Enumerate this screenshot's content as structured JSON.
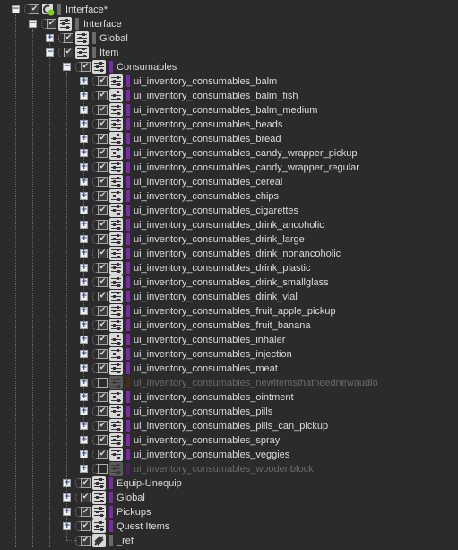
{
  "colors": {
    "background": "#2b2b2b",
    "text": "#dcdcdc",
    "text_disabled": "#6a6a6a",
    "bar_purple": "#7a2aa8",
    "bar_purple_disabled": "#4a1f5c",
    "bar_brown_disabled": "#4a2a14",
    "bar_gray": "#6b6b6b",
    "active_dot": "#7ed321"
  },
  "tree": {
    "root": {
      "label": "Interface*",
      "checked": true,
      "expanded": true,
      "icon": "workunit-active-icon"
    },
    "interface": {
      "label": "Interface",
      "checked": true,
      "expanded": true,
      "icon": "mixer-icon"
    },
    "global": {
      "label": "Global",
      "checked": true,
      "expanded": false,
      "icon": "mixer-icon"
    },
    "item": {
      "label": "Item",
      "checked": true,
      "expanded": true,
      "icon": "mixer-icon"
    },
    "consumables": {
      "label": "Consumables",
      "checked": true,
      "expanded": true,
      "icon": "mixer-icon"
    },
    "consumables_children": [
      {
        "label": "ui_inventory_consumables_balm",
        "checked": true,
        "enabled": true
      },
      {
        "label": "ui_inventory_consumables_balm_fish",
        "checked": true,
        "enabled": true
      },
      {
        "label": "ui_inventory_consumables_balm_medium",
        "checked": true,
        "enabled": true
      },
      {
        "label": "ui_inventory_consumables_beads",
        "checked": true,
        "enabled": true
      },
      {
        "label": "ui_inventory_consumables_bread",
        "checked": true,
        "enabled": true
      },
      {
        "label": "ui_inventory_consumables_candy_wrapper_pickup",
        "checked": true,
        "enabled": true
      },
      {
        "label": "ui_inventory_consumables_candy_wrapper_regular",
        "checked": true,
        "enabled": true
      },
      {
        "label": "ui_inventory_consumables_cereal",
        "checked": true,
        "enabled": true
      },
      {
        "label": "ui_inventory_consumables_chips",
        "checked": true,
        "enabled": true
      },
      {
        "label": "ui_inventory_consumables_cigarettes",
        "checked": true,
        "enabled": true
      },
      {
        "label": "ui_inventory_consumables_drink_ancoholic",
        "checked": true,
        "enabled": true
      },
      {
        "label": "ui_inventory_consumables_drink_large",
        "checked": true,
        "enabled": true
      },
      {
        "label": "ui_inventory_consumables_drink_nonancoholic",
        "checked": true,
        "enabled": true
      },
      {
        "label": "ui_inventory_consumables_drink_plastic",
        "checked": true,
        "enabled": true
      },
      {
        "label": "ui_inventory_consumables_drink_smallglass",
        "checked": true,
        "enabled": true
      },
      {
        "label": "ui_inventory_consumables_drink_vial",
        "checked": true,
        "enabled": true
      },
      {
        "label": "ui_inventory_consumables_fruit_apple_pickup",
        "checked": true,
        "enabled": true
      },
      {
        "label": "ui_inventory_consumables_fruit_banana",
        "checked": true,
        "enabled": true
      },
      {
        "label": "ui_inventory_consumables_inhaler",
        "checked": true,
        "enabled": true
      },
      {
        "label": "ui_inventory_consumables_injection",
        "checked": true,
        "enabled": true
      },
      {
        "label": "ui_inventory_consumables_meat",
        "checked": true,
        "enabled": true
      },
      {
        "label": "ui_inventory_consumables_newitemsthatneednewaudio",
        "checked": false,
        "enabled": false,
        "bar": "brown"
      },
      {
        "label": "ui_inventory_consumables_ointment",
        "checked": true,
        "enabled": true
      },
      {
        "label": "ui_inventory_consumables_pills",
        "checked": true,
        "enabled": true
      },
      {
        "label": "ui_inventory_consumables_pills_can_pickup",
        "checked": true,
        "enabled": true
      },
      {
        "label": "ui_inventory_consumables_spray",
        "checked": true,
        "enabled": true
      },
      {
        "label": "ui_inventory_consumables_veggies",
        "checked": true,
        "enabled": true
      },
      {
        "label": "ui_inventory_consumables_woodenblock",
        "checked": false,
        "enabled": false,
        "bar": "purple"
      }
    ],
    "item_siblings": [
      {
        "label": "Equip-Unequip",
        "checked": true,
        "expanded": false
      },
      {
        "label": "Global",
        "checked": true,
        "expanded": false
      },
      {
        "label": "Pickups",
        "checked": true,
        "expanded": false
      },
      {
        "label": "Quest Items",
        "checked": true,
        "expanded": false
      }
    ],
    "ref": {
      "label": "_ref",
      "checked": true,
      "icon": "reference-icon"
    }
  },
  "glyphs": {
    "plus": "+",
    "minus": "−",
    "check": "✔"
  }
}
